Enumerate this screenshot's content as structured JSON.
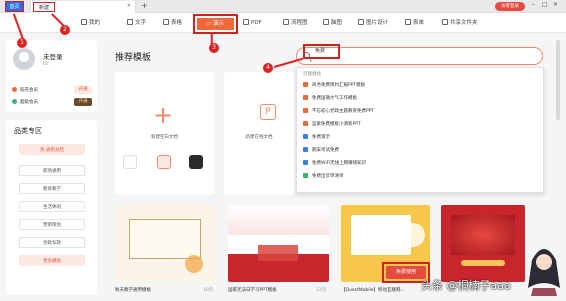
{
  "tabs": {
    "home": "首页",
    "new": "新建"
  },
  "login": "访客登录",
  "menu": [
    {
      "label": "我的",
      "icon": "home-icon"
    },
    {
      "label": "文字",
      "icon": "doc-icon"
    },
    {
      "label": "表格",
      "icon": "table-icon"
    },
    {
      "label": "演示",
      "icon": "ppt-icon"
    },
    {
      "label": "PDF",
      "icon": "pdf-icon"
    },
    {
      "label": "流程图",
      "icon": "flowchart-icon"
    },
    {
      "label": "脑图",
      "icon": "mindmap-icon"
    },
    {
      "label": "图片设计",
      "icon": "image-icon"
    },
    {
      "label": "表单",
      "icon": "form-icon"
    },
    {
      "label": "共享文件夹",
      "icon": "folder-icon"
    }
  ],
  "profile": {
    "name": "未登录",
    "id": "ID:",
    "vip1": "稻壳会员",
    "vip1_btn": "开通",
    "vip2": "超级会员",
    "vip2_btn": "开通"
  },
  "categories": {
    "title": "品类专区",
    "items": [
      "热·通用总结",
      "职场通用",
      "教育教学",
      "生活休闲",
      "营销策划",
      "党政军政",
      "更多模板"
    ]
  },
  "main": {
    "title": "推荐模板",
    "new_blank": "新建空白文档",
    "new_online": "新建在线文档"
  },
  "search": {
    "value": "免费"
  },
  "dropdown": {
    "header": "可能想找",
    "items": [
      {
        "text": "商务免费简约汇报PPT模板",
        "icon": "orange"
      },
      {
        "text": "免费国潮大气工作模板",
        "icon": "orange"
      },
      {
        "text": "不忘初心党政主题教育免费PPT",
        "icon": "orange"
      },
      {
        "text": "蓝紫免费模板小清新PPT",
        "icon": "orange"
      },
      {
        "text": "免费演示",
        "icon": "blue"
      },
      {
        "text": "期末考试免费",
        "icon": "blue"
      },
      {
        "text": "免费WiFi无线上网赚钱知识",
        "icon": "blue"
      },
      {
        "text": "免费出货单清单",
        "icon": "green"
      }
    ]
  },
  "thumbs": [
    {
      "caption": "秋天教学通用模板",
      "count": "10页"
    },
    {
      "caption": "国家宪法日学习PPT模板",
      "count": "22页"
    },
    {
      "caption": "【QuestMobile】移动互联网...",
      "count": ""
    },
    {
      "caption": "",
      "count": ""
    }
  ],
  "use_button": "免费使用",
  "markers": [
    "1",
    "2",
    "3",
    "4"
  ],
  "watermark": "头条 @桐楠子aaa",
  "colors": {
    "accent": "#f0673a",
    "annotation": "#cc2222",
    "primary": "#2f6fe0"
  }
}
